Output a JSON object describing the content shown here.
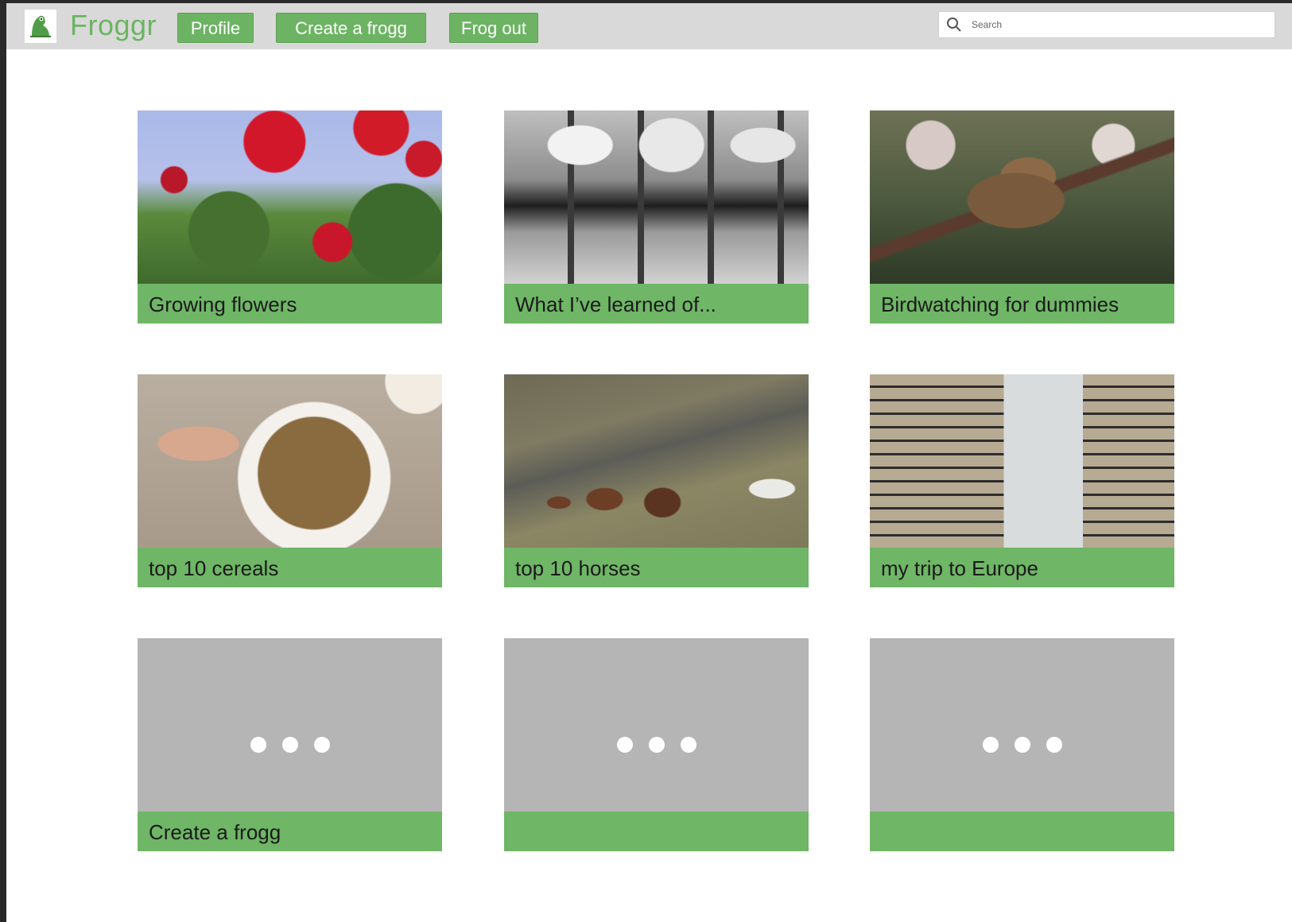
{
  "app": {
    "name": "Froggr",
    "accent_color": "#6cb463",
    "logo_icon": "frog-icon"
  },
  "nav": {
    "profile_label": "Profile",
    "create_label": "Create a frogg",
    "logout_label": "Frog out"
  },
  "search": {
    "placeholder": "Search",
    "icon": "search-icon"
  },
  "cards": [
    {
      "title": "Growing flowers",
      "image": "roses-photo"
    },
    {
      "title": "What I’ve learned of...",
      "image": "opera-hall-photo"
    },
    {
      "title": "Birdwatching for dummies",
      "image": "sparrow-photo"
    },
    {
      "title": "top 10 cereals",
      "image": "cereal-bowl-photo"
    },
    {
      "title": "top 10 horses",
      "image": "horses-photo"
    },
    {
      "title": "my trip to Europe",
      "image": "paris-street-photo"
    },
    {
      "title": "Create a frogg",
      "image": "placeholder"
    },
    {
      "title": "",
      "image": "placeholder"
    },
    {
      "title": "",
      "image": "placeholder"
    }
  ]
}
